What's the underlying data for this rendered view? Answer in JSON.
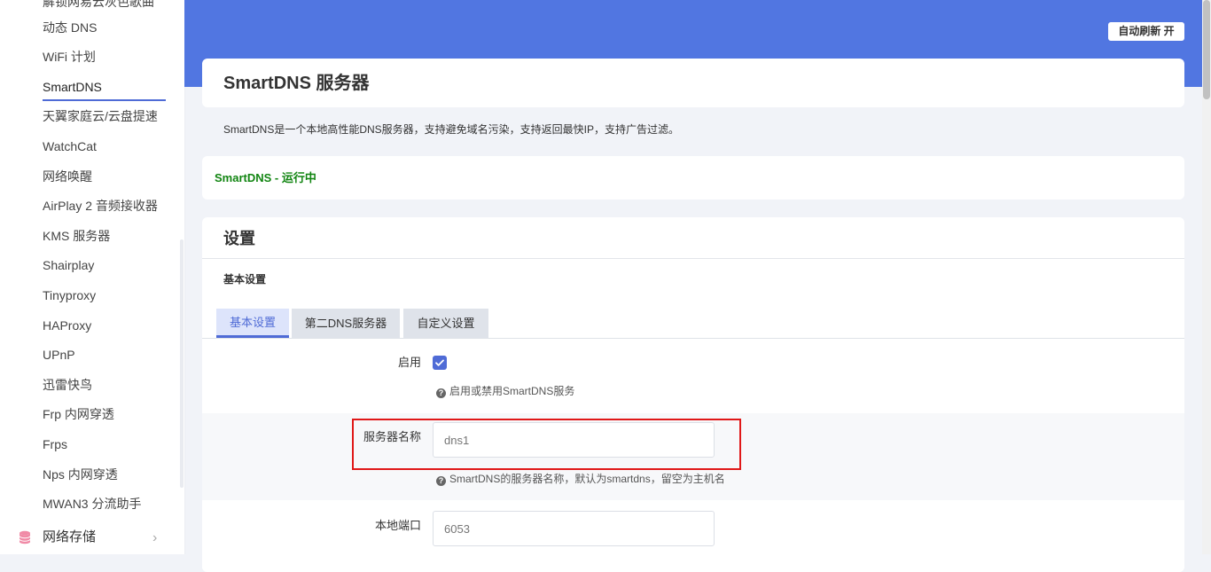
{
  "sidebar": {
    "items": [
      {
        "label": "解锁网易云灰色歌曲"
      },
      {
        "label": "动态 DNS"
      },
      {
        "label": "WiFi 计划"
      },
      {
        "label": "SmartDNS"
      },
      {
        "label": "天翼家庭云/云盘提速"
      },
      {
        "label": "WatchCat"
      },
      {
        "label": "网络唤醒"
      },
      {
        "label": "AirPlay 2 音频接收器"
      },
      {
        "label": "KMS 服务器"
      },
      {
        "label": "Shairplay"
      },
      {
        "label": "Tinyproxy"
      },
      {
        "label": "HAProxy"
      },
      {
        "label": "UPnP"
      },
      {
        "label": "迅雷快鸟"
      },
      {
        "label": "Frp 内网穿透"
      },
      {
        "label": "Frps"
      },
      {
        "label": "Nps 内网穿透"
      },
      {
        "label": "MWAN3 分流助手"
      }
    ],
    "active_index": 3,
    "section": {
      "label": "网络存储",
      "icon": "database-icon",
      "chevron": "chevron-right-icon"
    }
  },
  "header": {
    "refresh_label": "自动刷新 开",
    "banner_color": "#5176e1"
  },
  "page": {
    "title": "SmartDNS 服务器",
    "description": "SmartDNS是一个本地高性能DNS服务器，支持避免域名污染，支持返回最快IP，支持广告过滤。",
    "status": "SmartDNS - 运行中",
    "status_color": "#118511"
  },
  "settings": {
    "title": "设置",
    "subtitle": "基本设置",
    "tabs": [
      {
        "label": "基本设置",
        "active": true
      },
      {
        "label": "第二DNS服务器",
        "active": false
      },
      {
        "label": "自定义设置",
        "active": false
      }
    ],
    "fields": {
      "enable": {
        "label": "启用",
        "checked": true,
        "hint": "启用或禁用SmartDNS服务"
      },
      "server_name": {
        "label": "服务器名称",
        "placeholder": "dns1",
        "hint": "SmartDNS的服务器名称，默认为smartdns，留空为主机名"
      },
      "port": {
        "label": "本地端口",
        "placeholder": "6053"
      }
    }
  },
  "accent_color": "#4f6bd6",
  "highlight_color": "#e01818"
}
